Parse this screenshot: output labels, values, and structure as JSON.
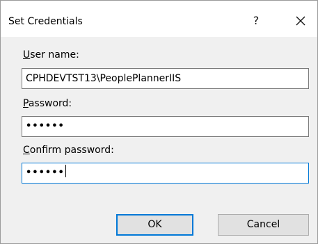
{
  "dialog": {
    "title": "Set Credentials",
    "help_label": "?"
  },
  "username": {
    "label_accel": "U",
    "label_rest": "ser name:",
    "value": "CPHDEVTST13\\PeoplePlannerIIS"
  },
  "password": {
    "label_accel": "P",
    "label_rest": "assword:",
    "value": "••••••"
  },
  "confirm": {
    "label_accel": "C",
    "label_rest": "onfirm password:",
    "value": "••••••"
  },
  "buttons": {
    "ok_label": "OK",
    "cancel_label": "Cancel"
  },
  "colors": {
    "focus_accent": "#0078d7",
    "dialog_background": "#f0f0f0",
    "titlebar_background": "#ffffff"
  },
  "icons": {
    "close": "close-icon",
    "help": "help-button"
  }
}
